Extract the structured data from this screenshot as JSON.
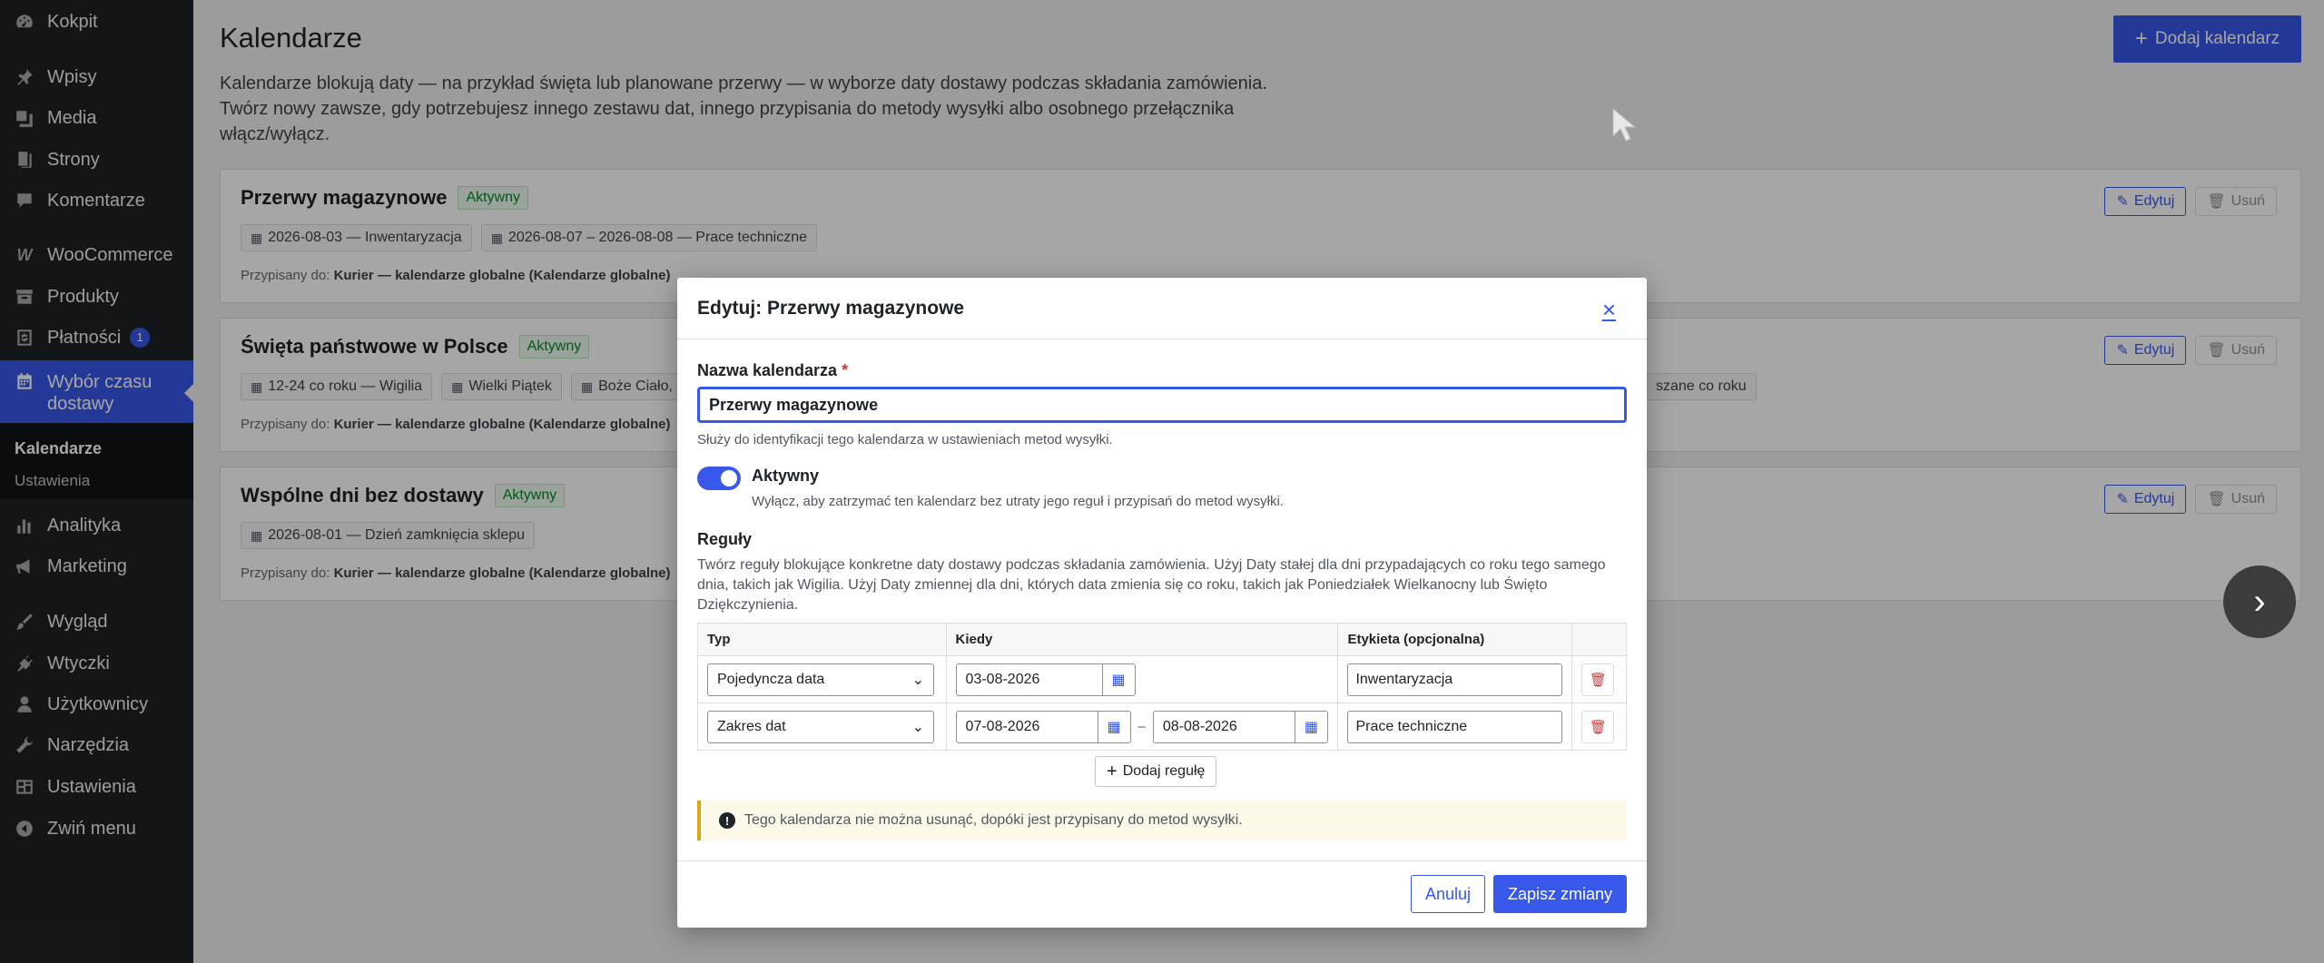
{
  "sidebar": {
    "items": [
      {
        "label": "Kokpit",
        "icon": "dashboard-icon"
      },
      {
        "label": "Wpisy",
        "icon": "pin-icon"
      },
      {
        "label": "Media",
        "icon": "media-icon"
      },
      {
        "label": "Strony",
        "icon": "pages-icon"
      },
      {
        "label": "Komentarze",
        "icon": "comment-icon"
      },
      {
        "label": "WooCommerce",
        "icon": "woo-icon"
      },
      {
        "label": "Produkty",
        "icon": "archive-icon"
      },
      {
        "label": "Płatności",
        "icon": "payments-icon",
        "badge": "1"
      },
      {
        "label": "Wybór czasu dostawy",
        "icon": "calendar-icon"
      },
      {
        "label": "Analityka",
        "icon": "bar-chart-icon"
      },
      {
        "label": "Marketing",
        "icon": "megaphone-icon"
      },
      {
        "label": "Wygląd",
        "icon": "brush-icon"
      },
      {
        "label": "Wtyczki",
        "icon": "plugin-icon"
      },
      {
        "label": "Użytkownicy",
        "icon": "user-icon"
      },
      {
        "label": "Narzędzia",
        "icon": "wrench-icon"
      },
      {
        "label": "Ustawienia",
        "icon": "settings-icon"
      },
      {
        "label": "Zwiń menu",
        "icon": "collapse-icon"
      }
    ],
    "submenu": [
      {
        "label": "Kalendarze"
      },
      {
        "label": "Ustawienia"
      }
    ]
  },
  "page": {
    "title": "Kalendarze",
    "add_button": "Dodaj kalendarz",
    "description": "Kalendarze blokują daty — na przykład święta lub planowane przerwy — w wyborze daty dostawy podczas składania zamówienia. Twórz nowy zawsze, gdy potrzebujesz innego zestawu dat, innego przypisania do metody wysyłki albo osobnego przełącznika włącz/wyłącz."
  },
  "cards": [
    {
      "title": "Przerwy magazynowe",
      "status": "Aktywny",
      "chips": [
        "2026-08-03 — Inwentaryzacja",
        "2026-08-07 – 2026-08-08 — Prace techniczne"
      ],
      "assigned_prefix": "Przypisany do:",
      "assigned": "Kurier — kalendarze globalne (Kalendarze globalne)",
      "edit": "Edytuj",
      "delete": "Usuń"
    },
    {
      "title": "Święta państwowe w Polsce",
      "status": "Aktywny",
      "chips": [
        "12-24 co roku — Wigilia",
        "Wielki Piątek",
        "Boże Ciało,"
      ],
      "chip_right": "szane co roku",
      "assigned_prefix": "Przypisany do:",
      "assigned": "Kurier — kalendarze globalne (Kalendarze globalne)",
      "edit": "Edytuj",
      "delete": "Usuń"
    },
    {
      "title": "Wspólne dni bez dostawy",
      "status": "Aktywny",
      "chips": [
        "2026-08-01 — Dzień zamknięcia sklepu"
      ],
      "assigned_prefix": "Przypisany do:",
      "assigned": "Kurier — kalendarze globalne (Kalendarze globalne)",
      "edit": "Edytuj",
      "delete": "Usuń"
    }
  ],
  "modal": {
    "title": "Edytuj: Przerwy magazynowe",
    "close": "×",
    "name_label": "Nazwa kalendarza",
    "required": "*",
    "name_value": "Przerwy magazynowe",
    "name_help": "Służy do identyfikacji tego kalendarza w ustawieniach metod wysyłki.",
    "toggle_label": "Aktywny",
    "toggle_on": true,
    "toggle_help": "Wyłącz, aby zatrzymać ten kalendarz bez utraty jego reguł i przypisań do metod wysyłki.",
    "rules_label": "Reguły",
    "rules_desc": "Twórz reguły blokujące konkretne daty dostawy podczas składania zamówienia. Użyj Daty stałej dla dni przypadających co roku tego samego dnia, takich jak Wigilia. Użyj Daty zmiennej dla dni, których data zmienia się co roku, takich jak Poniedziałek Wielkanocny lub Święto Dziękczynienia.",
    "table": {
      "headers": [
        "Typ",
        "Kiedy",
        "Etykieta (opcjonalna)",
        ""
      ],
      "rows": [
        {
          "type": "Pojedyncza data",
          "from": "03-08-2026",
          "to": "",
          "label": "Inwentaryzacja"
        },
        {
          "type": "Zakres dat",
          "from": "07-08-2026",
          "to": "08-08-2026",
          "label": "Prace techniczne"
        }
      ]
    },
    "range_separator": "–",
    "add_rule": "Dodaj regułę",
    "notice": "Tego kalendarza nie można usunąć, dopóki jest przypisany do metod wysyłki.",
    "cancel": "Anuluj",
    "save": "Zapisz zmiany"
  },
  "colors": {
    "accent": "#3858e9",
    "sidebar_bg": "#1d2327",
    "active_green": "#008a20",
    "danger": "#d63638",
    "notice_border": "#dba617"
  }
}
